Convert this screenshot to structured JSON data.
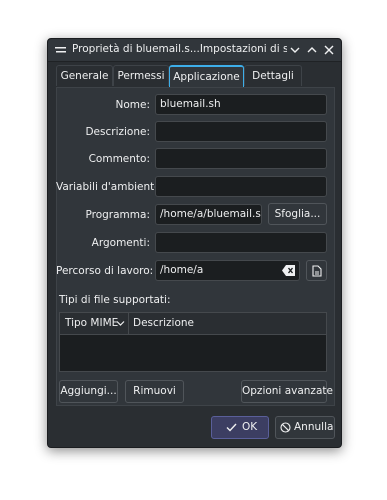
{
  "window": {
    "title": "Proprietà di bluemail.s...Impostazioni di sistema",
    "icons": [
      "menu-icon",
      "chevron-down-icon",
      "chevron-up-icon",
      "close-icon"
    ]
  },
  "tabs": [
    {
      "label": "Generale",
      "active": false
    },
    {
      "label": "Permessi",
      "active": false
    },
    {
      "label": "Applicazione",
      "active": true
    },
    {
      "label": "Dettagli",
      "active": false
    }
  ],
  "form": {
    "name": {
      "label": "Nome:",
      "value": "bluemail.sh"
    },
    "description": {
      "label": "Descrizione:",
      "value": ""
    },
    "comment": {
      "label": "Commento:",
      "value": ""
    },
    "env_vars": {
      "label": "Variabili d'ambiente:",
      "value": ""
    },
    "program": {
      "label": "Programma:",
      "value": "/home/a/bluemail.sh",
      "browse_label": "Sfoglia..."
    },
    "arguments": {
      "label": "Argomenti:",
      "value": ""
    },
    "workdir": {
      "label": "Percorso di lavoro:",
      "value": "/home/a"
    }
  },
  "filetypes": {
    "title": "Tipi di file supportati:",
    "columns": [
      "Tipo MIME",
      "Descrizione"
    ],
    "rows": []
  },
  "actions": {
    "add": "Aggiungi...",
    "remove": "Rimuovi",
    "advanced": "Opzioni avanzate"
  },
  "footer": {
    "ok": "OK",
    "cancel": "Annulla"
  },
  "colors": {
    "accent": "#3daee9",
    "background": "#2a2e32",
    "field": "#1b1e20"
  }
}
